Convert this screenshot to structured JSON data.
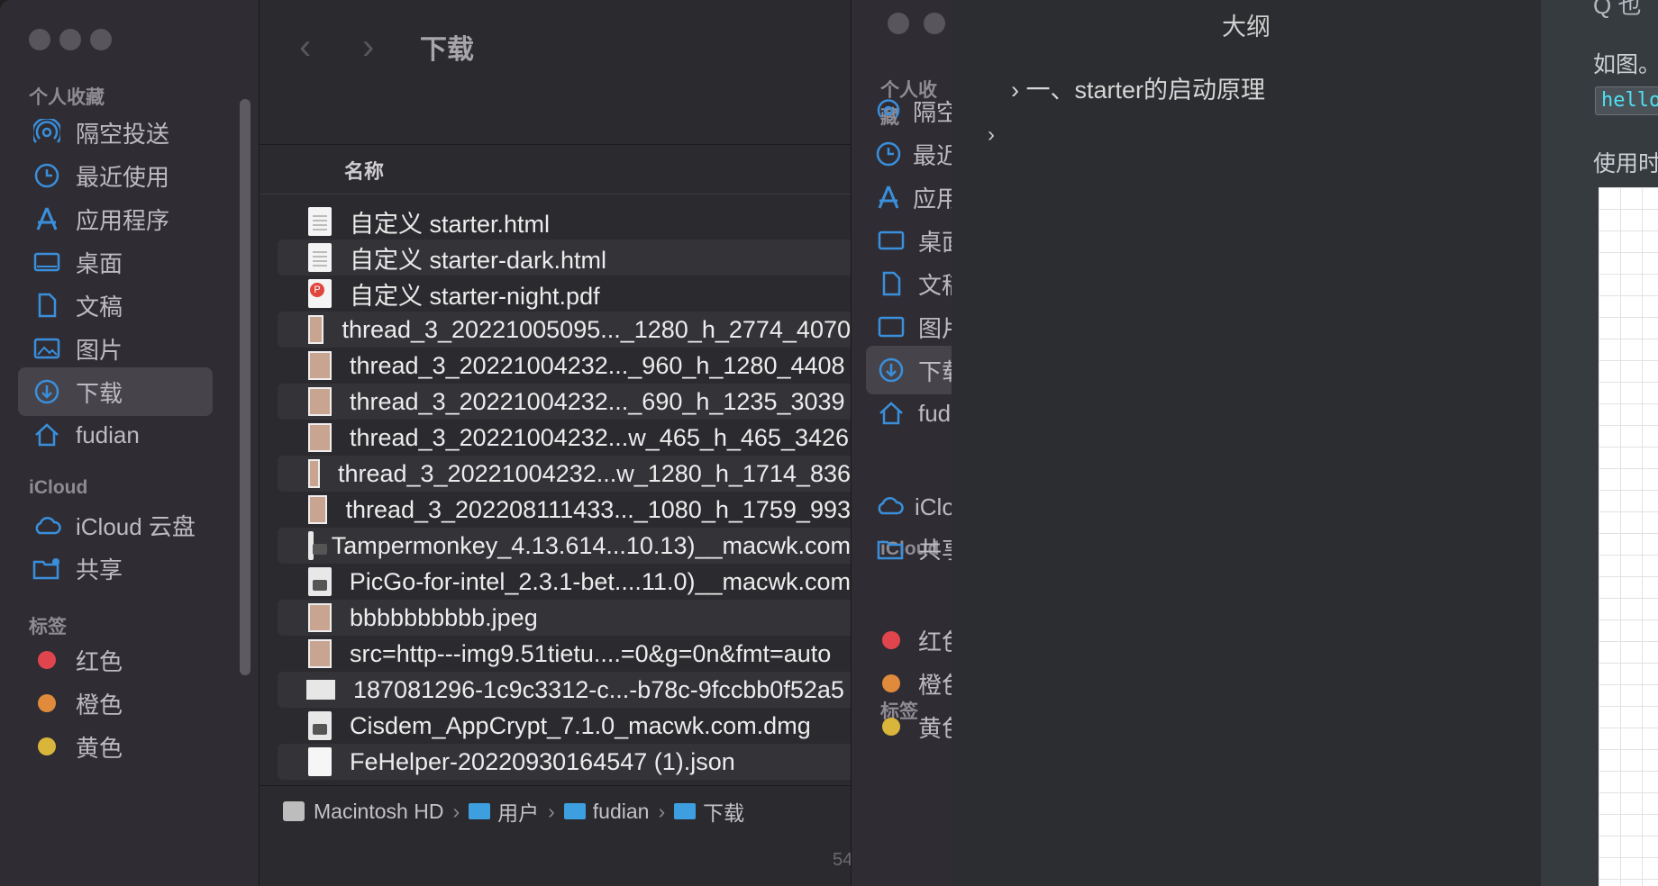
{
  "finder": {
    "sidebar": {
      "favorites_title": "个人收藏",
      "favorites": [
        {
          "label": "隔空投送",
          "icon": "airdrop-icon"
        },
        {
          "label": "最近使用",
          "icon": "clock-icon"
        },
        {
          "label": "应用程序",
          "icon": "applications-icon"
        },
        {
          "label": "桌面",
          "icon": "desktop-icon"
        },
        {
          "label": "文稿",
          "icon": "document-icon"
        },
        {
          "label": "图片",
          "icon": "photo-icon"
        },
        {
          "label": "下载",
          "icon": "download-icon"
        },
        {
          "label": "fudian",
          "icon": "home-icon"
        }
      ],
      "icloud_title": "iCloud",
      "icloud": [
        {
          "label": "iCloud 云盘",
          "icon": "cloud-icon"
        },
        {
          "label": "共享",
          "icon": "shared-folder-icon"
        }
      ],
      "tags_title": "标签",
      "tags": [
        {
          "label": "红色",
          "color": "#e0454d"
        },
        {
          "label": "橙色",
          "color": "#e08a3c"
        },
        {
          "label": "黄色",
          "color": "#d9b53b"
        }
      ]
    },
    "toolbar": {
      "back": "‹",
      "forward": "›",
      "title": "下载"
    },
    "column_header": "名称",
    "files": [
      {
        "name": "自定义 starter.html",
        "type": "doc"
      },
      {
        "name": "自定义 starter-dark.html",
        "type": "doc"
      },
      {
        "name": "自定义 starter-night.pdf",
        "type": "pdf"
      },
      {
        "name": "thread_3_20221005095..._1280_h_2774_4070",
        "type": "img"
      },
      {
        "name": "thread_3_20221004232..._960_h_1280_4408",
        "type": "img"
      },
      {
        "name": "thread_3_20221004232..._690_h_1235_3039",
        "type": "img"
      },
      {
        "name": "thread_3_20221004232...w_465_h_465_3426",
        "type": "img"
      },
      {
        "name": "thread_3_20221004232...w_1280_h_1714_836",
        "type": "img"
      },
      {
        "name": "thread_3_202208111433..._1080_h_1759_993",
        "type": "img"
      },
      {
        "name": "Tampermonkey_4.13.614...10.13)__macwk.com",
        "type": "dmg"
      },
      {
        "name": "PicGo-for-intel_2.3.1-bet....11.0)__macwk.com",
        "type": "dmg"
      },
      {
        "name": "bbbbbbbbbb.jpeg",
        "type": "img"
      },
      {
        "name": "src=http---img9.51tietu....=0&g=0n&fmt=auto",
        "type": "img"
      },
      {
        "name": "187081296-1c9c3312-c...-b78c-9fccbb0f52a5",
        "type": "wide"
      },
      {
        "name": "Cisdem_AppCrypt_7.1.0_macwk.com.dmg",
        "type": "dmg"
      },
      {
        "name": "FeHelper-20220930164547 (1).json",
        "type": "json"
      }
    ],
    "path": [
      "Macintosh HD",
      "用户",
      "fudian",
      "下载"
    ],
    "status": "54"
  },
  "finder2": {
    "favorites_title": "个人收藏",
    "favorites": [
      "隔空投送",
      "最近使用",
      "应用程序",
      "桌面",
      "文稿",
      "图片",
      "下载",
      "fudian"
    ],
    "icloud_title": "iCloud",
    "icloud": [
      "iCloud 云盘",
      "共享"
    ],
    "tags_title": "标签",
    "tags": [
      "红色",
      "橙色",
      "黄色"
    ]
  },
  "typora": {
    "outline_title": "大纲",
    "outline_items": [
      "一、starter的启动原理",
      ""
    ],
    "editor_top": "Q 也",
    "editor_text1": "如图。",
    "editor_code": "hello",
    "editor_text2": "使用时"
  }
}
